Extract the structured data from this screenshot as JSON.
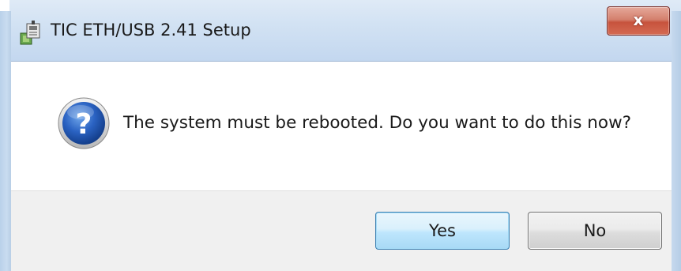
{
  "window": {
    "title": "TIC ETH/USB 2.41 Setup",
    "close_label": "x"
  },
  "dialog": {
    "icon": "question-icon",
    "message": "The system must be rebooted. Do you want to do this now?"
  },
  "buttons": {
    "yes_label": "Yes",
    "no_label": "No"
  },
  "colors": {
    "titlebar": "#d2e2f3",
    "close_button": "#c7533d",
    "default_button": "#bee6fd",
    "footer": "#f0f0f0"
  }
}
